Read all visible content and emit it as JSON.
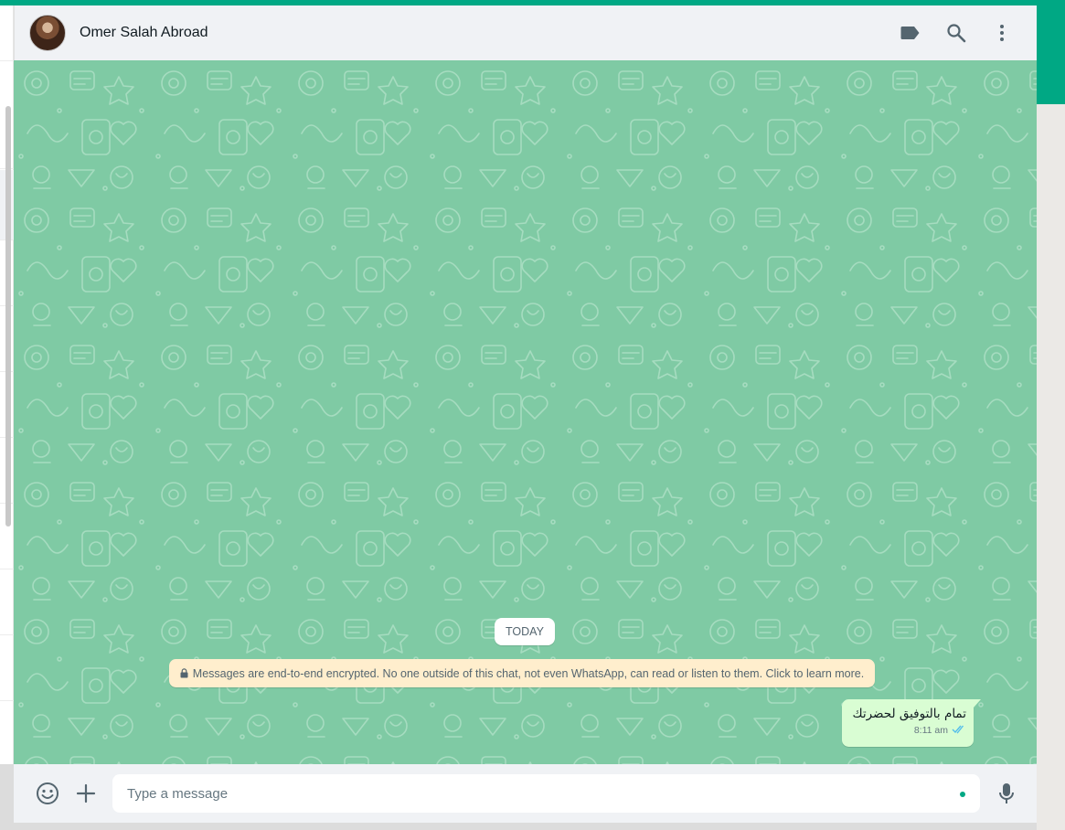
{
  "colors": {
    "accent": "#00a884",
    "chat_background": "#7fcaa4",
    "header_background": "#f0f2f5",
    "outgoing_bubble": "#d9fdd3",
    "system_notice": "#ffeecd",
    "tick_read": "#53bdeb"
  },
  "header": {
    "contact_name": "Omer Salah Abroad",
    "icons": [
      "label-icon",
      "search-icon",
      "menu-icon"
    ]
  },
  "chat": {
    "date_divider": "TODAY",
    "encryption_notice": "Messages are end-to-end encrypted. No one outside of this chat, not even WhatsApp, can read or listen to them. Click to learn more.",
    "messages": [
      {
        "direction": "outgoing",
        "text": "تمام بالتوفيق لحضرتك",
        "time": "8:11 am",
        "status": "read"
      }
    ]
  },
  "footer": {
    "placeholder": "Type a message",
    "icons": [
      "emoji-icon",
      "plus-icon",
      "mic-icon"
    ]
  }
}
